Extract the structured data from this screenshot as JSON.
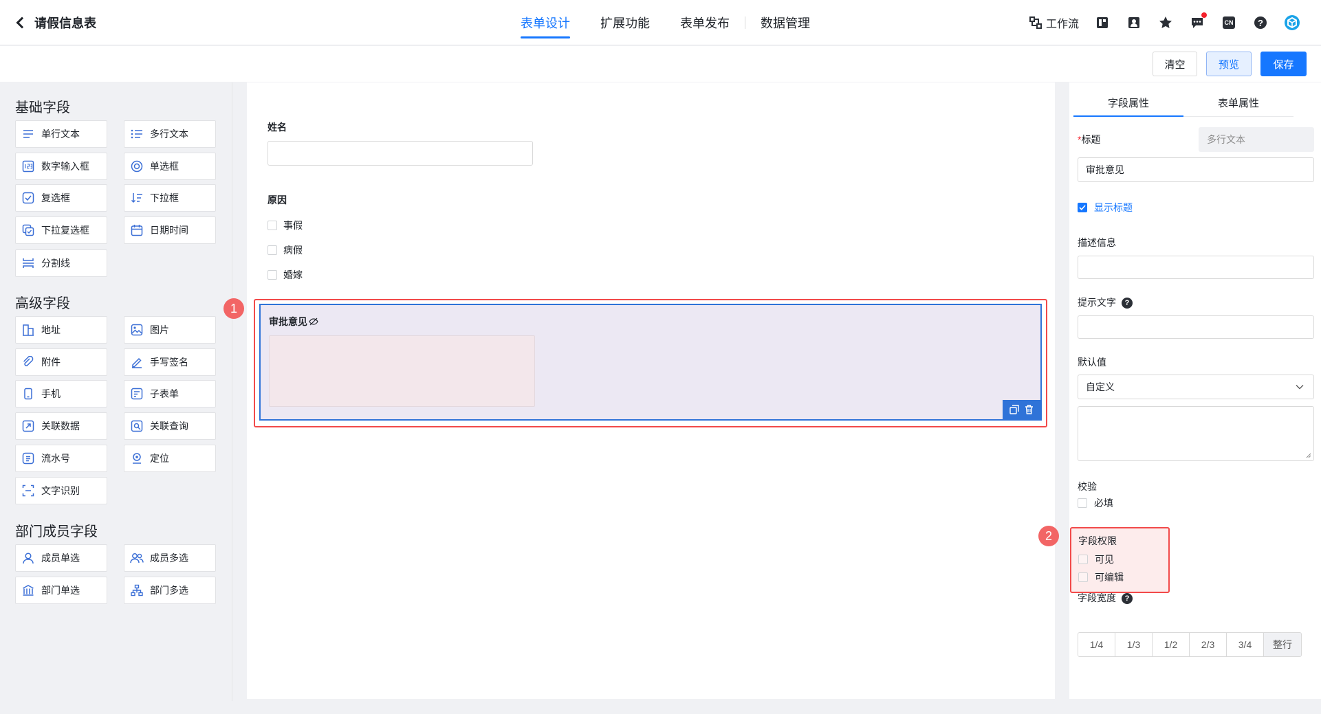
{
  "header": {
    "back_title": "请假信息表",
    "tabs": [
      {
        "label": "表单设计",
        "active": true
      },
      {
        "label": "扩展功能"
      },
      {
        "label": "表单发布"
      },
      {
        "label": "数据管理"
      }
    ],
    "workflow_label": "工作流",
    "icons": [
      "layout-icon",
      "contacts-icon",
      "star-icon",
      "message-icon",
      "language-icon",
      "help-icon",
      "app-logo-icon"
    ],
    "language_badge": "CN"
  },
  "actions": {
    "clear": "清空",
    "preview": "预览",
    "save": "保存"
  },
  "left": {
    "basic_title": "基础字段",
    "basic": [
      {
        "label": "单行文本",
        "icon": "single-line-icon"
      },
      {
        "label": "多行文本",
        "icon": "multi-line-icon"
      },
      {
        "label": "数字输入框",
        "icon": "number-icon"
      },
      {
        "label": "单选框",
        "icon": "radio-icon"
      },
      {
        "label": "复选框",
        "icon": "checkbox-icon"
      },
      {
        "label": "下拉框",
        "icon": "dropdown-icon"
      },
      {
        "label": "下拉复选框",
        "icon": "dropdown-checkbox-icon"
      },
      {
        "label": "日期时间",
        "icon": "calendar-icon"
      },
      {
        "label": "分割线",
        "icon": "divider-icon"
      }
    ],
    "advanced_title": "高级字段",
    "advanced": [
      {
        "label": "地址",
        "icon": "address-icon"
      },
      {
        "label": "图片",
        "icon": "image-icon"
      },
      {
        "label": "附件",
        "icon": "attachment-icon"
      },
      {
        "label": "手写签名",
        "icon": "signature-icon"
      },
      {
        "label": "手机",
        "icon": "phone-icon"
      },
      {
        "label": "子表单",
        "icon": "subform-icon"
      },
      {
        "label": "关联数据",
        "icon": "link-data-icon"
      },
      {
        "label": "关联查询",
        "icon": "link-query-icon"
      },
      {
        "label": "流水号",
        "icon": "serial-number-icon"
      },
      {
        "label": "定位",
        "icon": "location-icon"
      },
      {
        "label": "文字识别",
        "icon": "ocr-icon"
      }
    ],
    "member_title": "部门成员字段",
    "member": [
      {
        "label": "成员单选",
        "icon": "member-single-icon"
      },
      {
        "label": "成员多选",
        "icon": "member-multi-icon"
      },
      {
        "label": "部门单选",
        "icon": "department-single-icon"
      },
      {
        "label": "部门多选",
        "icon": "department-multi-icon"
      }
    ]
  },
  "canvas": {
    "name_label": "姓名",
    "reason_label": "原因",
    "reason_options": [
      "事假",
      "病假",
      "婚嫁"
    ],
    "approval_label": "审批意见",
    "marker1": "1",
    "marker2": "2"
  },
  "props": {
    "tabs": [
      "字段属性",
      "表单属性"
    ],
    "title_required_mark": "*",
    "title_label": "标题",
    "field_type": "多行文本",
    "title_value": "审批意见",
    "show_title": "显示标题",
    "desc_label": "描述信息",
    "hint_label": "提示文字",
    "default_label": "默认值",
    "default_value": "自定义",
    "validate_label": "校验",
    "required": "必填",
    "perm_label": "字段权限",
    "visible": "可见",
    "editable": "可编辑",
    "width_label": "字段宽度",
    "widths": [
      "1/4",
      "1/3",
      "1/2",
      "2/3",
      "3/4",
      "整行"
    ],
    "width_selected": "整行",
    "help_glyph": "?"
  }
}
